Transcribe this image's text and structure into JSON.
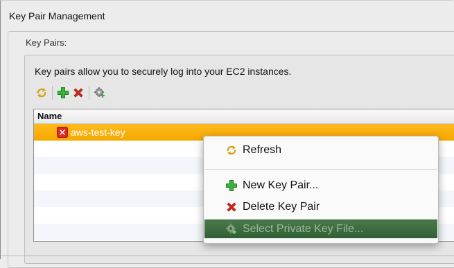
{
  "panel": {
    "title": "Key Pair Management",
    "group_label": "Key Pairs:",
    "description": "Key pairs allow you to securely log into your EC2 instances."
  },
  "toolbar": {
    "items": [
      {
        "icon": "refresh-icon"
      },
      {
        "icon": "add-icon"
      },
      {
        "icon": "delete-icon"
      },
      {
        "icon": "gear-add-icon"
      }
    ]
  },
  "table": {
    "columns": [
      "Name"
    ],
    "rows": [
      {
        "name": "aws-test-key",
        "selected": true
      }
    ]
  },
  "context_menu": {
    "items": [
      {
        "label": "Refresh",
        "icon": "refresh-icon"
      },
      {
        "label": "New Key Pair...",
        "icon": "add-icon"
      },
      {
        "label": "Delete Key Pair",
        "icon": "delete-icon"
      },
      {
        "label": "Select Private Key File...",
        "icon": "gear-add-icon",
        "highlighted": true
      }
    ]
  },
  "colors": {
    "selection": "#f8ad00",
    "menu_highlight": "#3b6b3f",
    "add_green": "#3cb23c",
    "delete_red": "#d9261c"
  }
}
